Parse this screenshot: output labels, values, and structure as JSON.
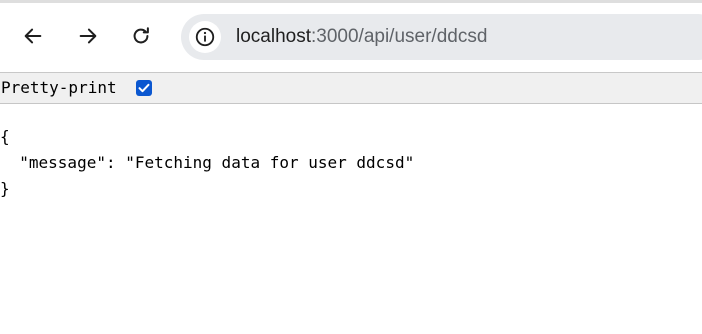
{
  "browser": {
    "url_host": "localhost",
    "url_path": ":3000/api/user/ddcsd"
  },
  "pretty_print": {
    "label": "Pretty-print",
    "checked": true
  },
  "json_view": {
    "open_brace": "{",
    "line": "  \"message\": \"Fetching data for user ddcsd\"",
    "close_brace": "}"
  },
  "icons": {
    "back": "arrow-left-icon",
    "forward": "arrow-right-icon",
    "reload": "reload-icon",
    "site_info": "info-circle-icon",
    "checkbox": "checkmark-icon"
  },
  "colors": {
    "checkbox": "#0b57d0",
    "omnibox_bg": "#e8eaed",
    "pretty_print_bar": "#f0f0f0"
  }
}
